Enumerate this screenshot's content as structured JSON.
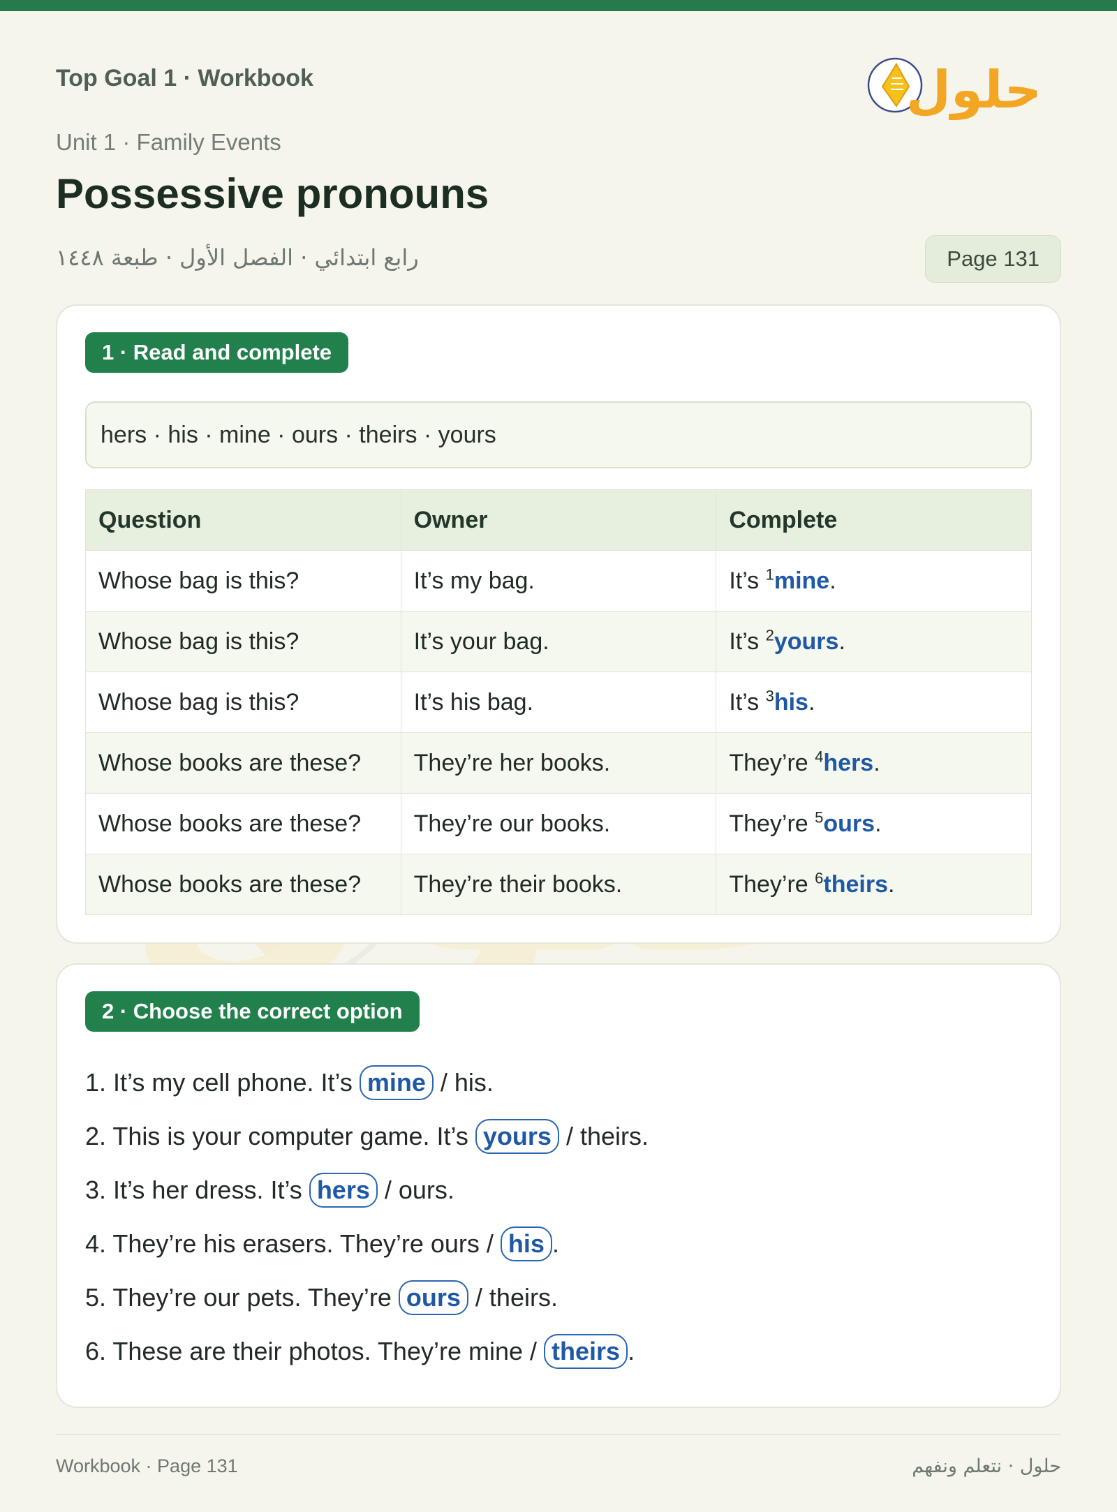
{
  "header": {
    "book_title": "Top Goal 1 · Workbook",
    "unit": "Unit 1 · Family Events",
    "title": "Possessive pronouns",
    "arabic_meta": "رابع ابتدائي · الفصل الأول · طبعة ١٤٤٨",
    "page_label": "Page 131",
    "logo_text": "حلول"
  },
  "section1": {
    "badge": "1 · Read and complete",
    "word_bank": "hers · his · mine · ours · theirs · yours",
    "columns": [
      "Question",
      "Owner",
      "Complete"
    ],
    "rows": [
      {
        "question": "Whose bag is this?",
        "owner": "It’s my bag.",
        "prefix": "It’s ",
        "num": "1",
        "answer": "mine",
        "suffix": "."
      },
      {
        "question": "Whose bag is this?",
        "owner": "It’s your bag.",
        "prefix": "It’s ",
        "num": "2",
        "answer": "yours",
        "suffix": "."
      },
      {
        "question": "Whose bag is this?",
        "owner": "It’s his bag.",
        "prefix": "It’s ",
        "num": "3",
        "answer": "his",
        "suffix": "."
      },
      {
        "question": "Whose books are these?",
        "owner": "They’re her books.",
        "prefix": "They’re ",
        "num": "4",
        "answer": "hers",
        "suffix": "."
      },
      {
        "question": "Whose books are these?",
        "owner": "They’re our books.",
        "prefix": "They’re ",
        "num": "5",
        "answer": "ours",
        "suffix": "."
      },
      {
        "question": "Whose books are these?",
        "owner": "They’re their books.",
        "prefix": "They’re ",
        "num": "6",
        "answer": "theirs",
        "suffix": "."
      }
    ]
  },
  "section2": {
    "badge": "2 · Choose the correct option",
    "items": [
      {
        "lead": "1. It’s my cell phone. It’s ",
        "choice": "mine",
        "tail": " / his."
      },
      {
        "lead": "2. This is your computer game. It’s ",
        "choice": "yours",
        "tail": " / theirs."
      },
      {
        "lead": "3. It’s her dress. It’s ",
        "choice": "hers",
        "tail": " / ours."
      },
      {
        "lead": "4. They’re his erasers. They’re ours / ",
        "choice": "his",
        "tail": "."
      },
      {
        "lead": "5. They’re our pets. They’re ",
        "choice": "ours",
        "tail": " / theirs."
      },
      {
        "lead": "6. These are their photos. They’re mine / ",
        "choice": "theirs",
        "tail": "."
      }
    ]
  },
  "footer": {
    "left": "Workbook · Page 131",
    "right": "حلول · نتعلم ونفهم"
  },
  "colors": {
    "brand_green": "#21804c",
    "answer_blue": "#1f58a5",
    "logo_orange": "#f2a623"
  },
  "icons": {
    "logo": "book-lightbulb-icon"
  }
}
